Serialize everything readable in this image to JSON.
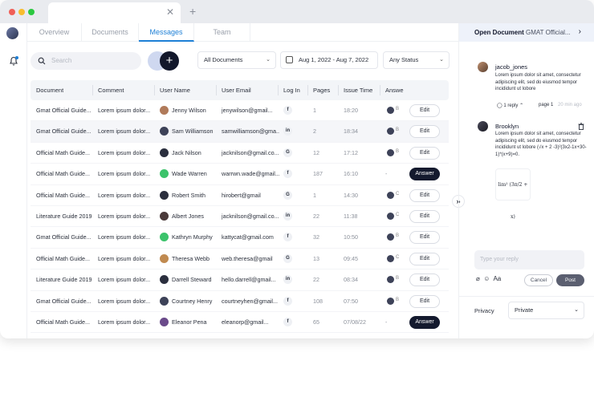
{
  "nav": {
    "tabs": [
      "Overview",
      "Documents",
      "Messages",
      "Team"
    ],
    "active": "Messages"
  },
  "toolbar": {
    "search_placeholder": "Search",
    "add_symbol": "+",
    "documents_filter": "All Documents",
    "date_range": "Aug 1, 2022 - Aug 7, 2022",
    "status_filter": "Any Status"
  },
  "table": {
    "headers": [
      "Document",
      "Comment",
      "User Name",
      "User Email",
      "Log In",
      "Pages",
      "Issue Time",
      "Answer"
    ],
    "rows": [
      {
        "document": "Gmat Official Guide...",
        "comment": "Lorem ipsum dolor...",
        "user": "Jenny Wilson",
        "email": "jenywilson@gmail...",
        "login": "f",
        "pages": "1",
        "time": "18:20",
        "answer": "B",
        "action": "Edit",
        "avatar": "#b07a5a"
      },
      {
        "document": "Gmat Official Guide...",
        "comment": "Lorem ipsum dolor...",
        "user": "Sam Williamson",
        "email": "samwilliamson@gma...",
        "login": "in",
        "pages": "2",
        "time": "18:34",
        "answer": "B",
        "action": "Edit",
        "avatar": "#3d4258"
      },
      {
        "document": "Official Math Guide...",
        "comment": "Lorem ipsum dolor...",
        "user": "Jack Nilson",
        "email": "jacknilson@gmail.co...",
        "login": "G",
        "pages": "12",
        "time": "17:12",
        "answer": "B",
        "action": "Edit",
        "avatar": "#2b2f3e"
      },
      {
        "document": "Official Math Guide...",
        "comment": "Lorem ipsum dolor...",
        "user": "Wade Warren",
        "email": "warrwn.wade@gmail...",
        "login": "f",
        "pages": "187",
        "time": "16:10",
        "answer": "-",
        "action": "Answer",
        "avatar": "#3cc36b"
      },
      {
        "document": "Official Math Guide...",
        "comment": "Lorem ipsum dolor...",
        "user": "Robert Smith",
        "email": "hirobert@gmail",
        "login": "G",
        "pages": "1",
        "time": "14:30",
        "answer": "C",
        "action": "Edit",
        "avatar": "#2b2f3e"
      },
      {
        "document": "Literature Guide 2019",
        "comment": "Lorem ipsum dolor...",
        "user": "Albert Jones",
        "email": "jacknilson@gmail.co...",
        "login": "in",
        "pages": "22",
        "time": "11:38",
        "answer": "C",
        "action": "Edit",
        "avatar": "#4a3a3a"
      },
      {
        "document": "Gmat Official Guide...",
        "comment": "Lorem ipsum dolor...",
        "user": "Kathryn Murphy",
        "email": "kattycat@gmail.com",
        "login": "f",
        "pages": "32",
        "time": "10:50",
        "answer": "B",
        "action": "Edit",
        "avatar": "#3cc36b"
      },
      {
        "document": "Official Math Guide...",
        "comment": "Lorem ipsum dolor...",
        "user": "Theresa Webb",
        "email": "web.theresa@gmail",
        "login": "G",
        "pages": "13",
        "time": "09:45",
        "answer": "C",
        "action": "Edit",
        "avatar": "#c08a50"
      },
      {
        "document": "Literature Guide 2019",
        "comment": "Lorem ipsum dolor...",
        "user": "Darrell Steward",
        "email": "hello.darrell@gmail...",
        "login": "in",
        "pages": "22",
        "time": "08:34",
        "answer": "B",
        "action": "Edit",
        "avatar": "#2b2f3e"
      },
      {
        "document": "Gmat Official Guide...",
        "comment": "Lorem ipsum dolor...",
        "user": "Courtney Henry",
        "email": "courtneyhen@gmail...",
        "login": "f",
        "pages": "108",
        "time": "07:50",
        "answer": "B",
        "action": "Edit",
        "avatar": "#3d4258"
      },
      {
        "document": "Official Math Guide...",
        "comment": "Lorem ipsum dolor...",
        "user": "Eleanor Pena",
        "email": "eleanorp@gmail...",
        "login": "f",
        "pages": "65",
        "time": "07/08/22",
        "answer": "-",
        "action": "Answer",
        "avatar": "#6a4a8a"
      }
    ]
  },
  "panel": {
    "title": "Open Document",
    "doc_name": "GMAT Official...",
    "comments": [
      {
        "name": "jacob_jones",
        "text": "Lorem ipsum dolor sit amet, consectetur adipiscing elit, sed do eiusmod tempor incididunt ut lobore",
        "replies": "1 reply",
        "page": "page 1",
        "time": "20 min ago"
      },
      {
        "name": "Brooklyn",
        "text": "Lorem ipsum dolor sit amet, consectetur adipiscing elit, sed do eiusmod tempor incididunt ut lobore (√x + 2 -3)²(3x2-1x+30-1)*(x+9)=0.",
        "formula": "lim² (3π/2 + x)"
      }
    ],
    "reply_placeholder": "Type your reply",
    "format_label": "Aa",
    "cancel": "Cancel",
    "post": "Post",
    "privacy_label": "Privacy",
    "privacy_value": "Private"
  },
  "colors": {
    "accent": "#1d7fd6",
    "dark": "#12172b",
    "post": "#5b5f70"
  },
  "icons": [
    "close-icon",
    "plus-icon",
    "bell-icon",
    "search-icon",
    "calendar-icon",
    "chevron-down-icon",
    "chevron-right-icon",
    "double-chevron-right-icon",
    "trash-icon",
    "clip-icon",
    "emoji-icon"
  ]
}
